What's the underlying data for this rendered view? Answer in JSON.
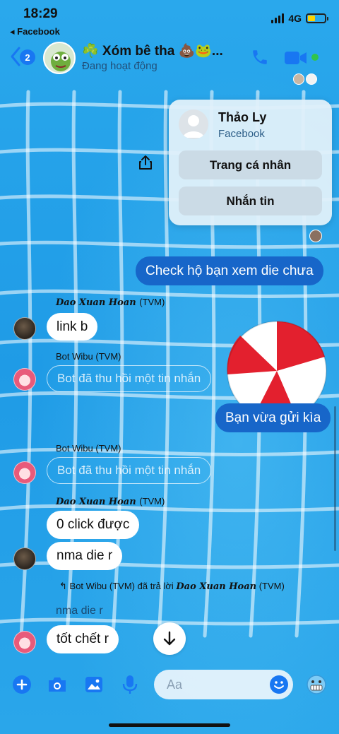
{
  "status_bar": {
    "time": "18:29",
    "back_app": "Facebook",
    "network": "4G",
    "battery_level_pct": 45
  },
  "header": {
    "back_badge_count": "2",
    "group_name": "☘️ Xóm bê tha 💩🐸...",
    "status": "Đang hoạt động",
    "call_icon": "phone-icon",
    "video_icon": "video-camera-icon"
  },
  "popover": {
    "name": "Thảo Ly",
    "source": "Facebook",
    "profile_button": "Trang cá nhân",
    "message_button": "Nhắn tin"
  },
  "messages": [
    {
      "type": "outgoing",
      "text": "Check hộ bạn xem die chưa"
    },
    {
      "type": "sender",
      "name": "Dao Xuan Hoan",
      "tag": "(TVM)"
    },
    {
      "type": "incoming",
      "text": "link b"
    },
    {
      "type": "sender",
      "name": "Bot Wibu",
      "tag": "(TVM)"
    },
    {
      "type": "recalled",
      "text": "Bot đã thu hồi một tin nhắn"
    },
    {
      "type": "outgoing",
      "text": "Bạn vừa gửi kìa"
    },
    {
      "type": "sender",
      "name": "Bot Wibu",
      "tag": "(TVM)"
    },
    {
      "type": "recalled",
      "text": "Bot đã thu hồi một tin nhắn"
    },
    {
      "type": "sender",
      "name": "Dao Xuan Hoan",
      "tag": "(TVM)"
    },
    {
      "type": "incoming",
      "text": "0 click được"
    },
    {
      "type": "incoming",
      "text": "nma die r"
    },
    {
      "type": "reply_header",
      "replier": "Bot Wibu (TVM)",
      "verb": "đã trả lời",
      "target": "Dao Xuan Hoan",
      "target_tag": "(TVM)"
    },
    {
      "type": "quoted",
      "text": "nma die r"
    },
    {
      "type": "incoming",
      "text": "tốt chết r"
    }
  ],
  "composer": {
    "placeholder": "Aa",
    "icons": [
      "plus-icon",
      "camera-icon",
      "gallery-icon",
      "microphone-icon",
      "emoji-icon",
      "quick-reaction-icon"
    ]
  },
  "colors": {
    "outgoing_bubble": "#1766c9",
    "pool": "#27a6ea",
    "accent": "#1877f2"
  }
}
